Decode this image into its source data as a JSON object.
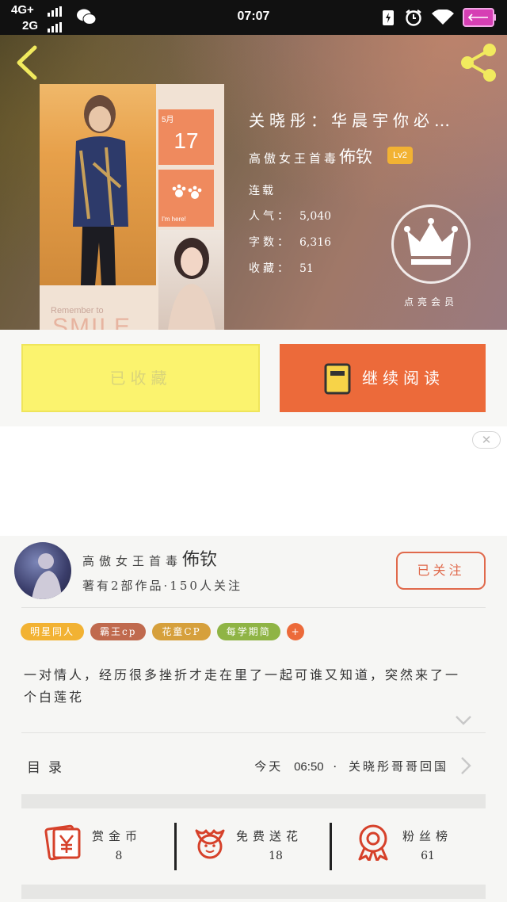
{
  "status_bar": {
    "network1": "4G+",
    "network2": "2G",
    "time": "07:07",
    "icons": [
      "wechat-icon",
      "battery-charging-icon",
      "alarm-icon",
      "wifi-icon",
      "battery-icon"
    ]
  },
  "nav": {
    "back_icon": "chevron-left-icon",
    "share_icon": "share-icon"
  },
  "cover": {
    "month": "5月",
    "day": "17",
    "tile_text": "I'm here!",
    "remember": "Remember to",
    "smile": "SMILE"
  },
  "book": {
    "title": "关晓彤：华晨宇你必…",
    "author_prefix": "高傲女王首毒",
    "author_name": "佈钦",
    "level": "Lv2",
    "status": "连载",
    "popularity_label": "人气：",
    "popularity": "5,040",
    "word_count_label": "字数：",
    "word_count": "6,316",
    "favorites_label": "收藏：",
    "favorites": "51",
    "crown_label": "点亮会员"
  },
  "actions": {
    "shelf_button": "已收藏",
    "read_button": "继续阅读"
  },
  "ad": {
    "close": "✕"
  },
  "author_card": {
    "name_prefix": "高傲女王首毒",
    "name": "佈钦",
    "works": "著有2部作品·150人关注",
    "follow_button": "已关注"
  },
  "tags": [
    {
      "label": "明星同人",
      "color": "#f2b233"
    },
    {
      "label": "霸王cp",
      "color": "#c06a4e"
    },
    {
      "label": "花童CP",
      "color": "#d6a03c"
    },
    {
      "label": "每学期简",
      "color": "#8fb445"
    },
    {
      "label": "+",
      "color": "#ec6a3a"
    }
  ],
  "intro": "一对情人，经历很多挫折才走在里了一起可谁又知道，突然来了一个白莲花",
  "toc": {
    "label": "目录",
    "update_day": "今天",
    "update_time": "06:50",
    "update_sep": "·",
    "update_chapter": "关晓彤哥哥回国"
  },
  "stats": [
    {
      "label": "赏金币",
      "value": "8",
      "icon": "red-envelope-yuan-icon"
    },
    {
      "label": "免费送花",
      "value": "18",
      "icon": "flower-icon"
    },
    {
      "label": "粉丝榜",
      "value": "61",
      "icon": "rosette-medal-icon"
    }
  ],
  "colors": {
    "accent": "#ec6a3a",
    "shelf_button": "#fbf36e",
    "level_badge": "#f2b233"
  }
}
